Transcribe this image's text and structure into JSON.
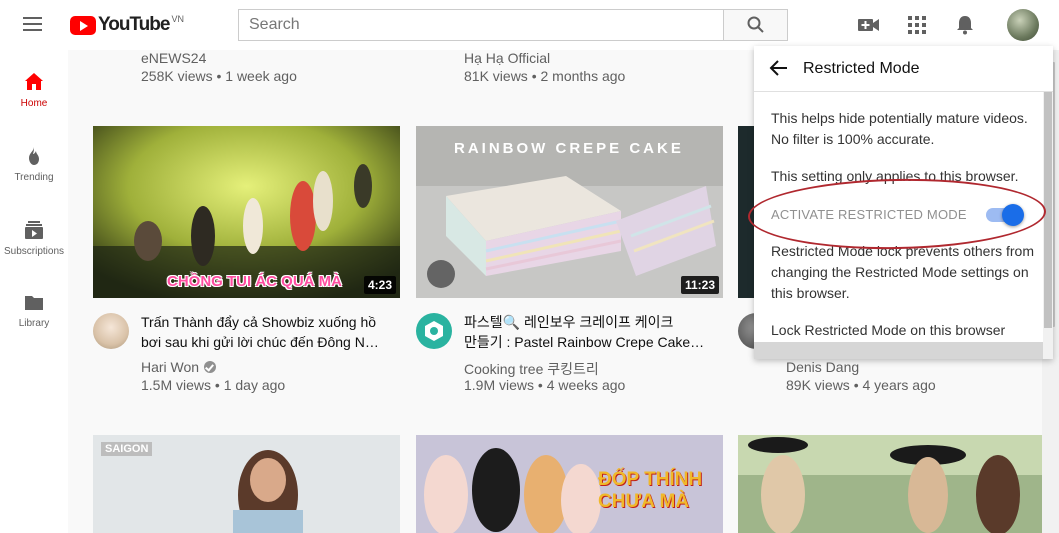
{
  "header": {
    "logo_text": "YouTube",
    "logo_region": "VN",
    "search_placeholder": "Search",
    "icons": [
      "menu-icon",
      "search-icon",
      "video-camera-icon",
      "apps-grid-icon",
      "bell-icon"
    ]
  },
  "sidebar": {
    "items": [
      {
        "label": "Home",
        "icon": "home-icon",
        "active": true
      },
      {
        "label": "Trending",
        "icon": "flame-icon",
        "active": false
      },
      {
        "label": "Subscriptions",
        "icon": "subscriptions-icon",
        "active": false
      },
      {
        "label": "Library",
        "icon": "folder-icon",
        "active": false
      }
    ]
  },
  "top_row": [
    {
      "channel": "eNEWS24",
      "meta": "258K views • 1 week ago"
    },
    {
      "channel": "Hạ Hạ Official",
      "meta": "81K views • 2 months ago"
    }
  ],
  "videos": [
    {
      "thumb_caption": "CHỒNG TUI ÁC QUÁ MÀ",
      "duration": "4:23",
      "title_line1": "Trấn Thành đẩy cả Showbiz xuống hồ",
      "title_line2": "bơi sau khi gửi lời chúc đến Đông N…",
      "channel": "Hari Won",
      "verified": true,
      "meta": "1.5M views • 1 day ago"
    },
    {
      "thumb_caption": "RAINBOW CREPE CAKE",
      "duration": "11:23",
      "title_line1": "파스텔🔍 레인보우 크레이프 케이크",
      "title_line2": "만들기 : Pastel Rainbow Crepe Cake…",
      "channel": "Cooking tree 쿠킹트리",
      "verified": false,
      "meta": "1.9M views • 4 weeks ago"
    },
    {
      "thumb_caption": "",
      "duration": "",
      "title_line1": "",
      "title_line2": "",
      "channel": "Denis Dang",
      "verified": false,
      "meta": "89K views • 4 years ago"
    }
  ],
  "bottom_row_captions": [
    "SAIGON",
    "ĐỐP THÍNH CHƯA MÀ",
    ""
  ],
  "restricted_panel": {
    "title": "Restricted Mode",
    "desc1": "This helps hide potentially mature videos. No filter is 100% accurate.",
    "desc2": "This setting only applies to this browser.",
    "toggle_label": "ACTIVATE RESTRICTED MODE",
    "toggle_on": true,
    "desc3": "Restricted Mode lock prevents others from changing the Restricted Mode settings on this browser.",
    "lock_link": "Lock Restricted Mode on this browser"
  },
  "colors": {
    "brand_red": "#ff0000",
    "toggle_blue": "#1a6de8",
    "annotation_red": "#b0282f"
  }
}
